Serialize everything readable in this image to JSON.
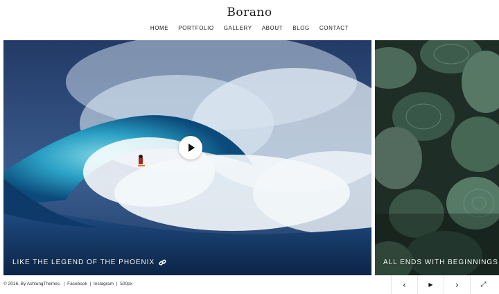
{
  "site": {
    "title": "Borano"
  },
  "nav": {
    "items": [
      {
        "label": "HOME"
      },
      {
        "label": "PORTFOLIO"
      },
      {
        "label": "GALLERY"
      },
      {
        "label": "ABOUT"
      },
      {
        "label": "BLOG"
      },
      {
        "label": "CONTACT"
      }
    ]
  },
  "slides": [
    {
      "caption": "LIKE THE LEGEND OF THE PHOENIX",
      "icon": "link-icon",
      "media": "play-icon"
    },
    {
      "caption": "ALL ENDS WITH BEGINNINGS"
    }
  ],
  "footer": {
    "copyright": "© 2016. By AchtungThemes.",
    "links": [
      "Facebook",
      "Instagram",
      "500px"
    ]
  },
  "controls": {
    "prev": "‹",
    "play": "▶",
    "next": "›",
    "fullscreen": "⤢"
  },
  "colors": {
    "accent": "#ffffff",
    "text": "#222222"
  }
}
